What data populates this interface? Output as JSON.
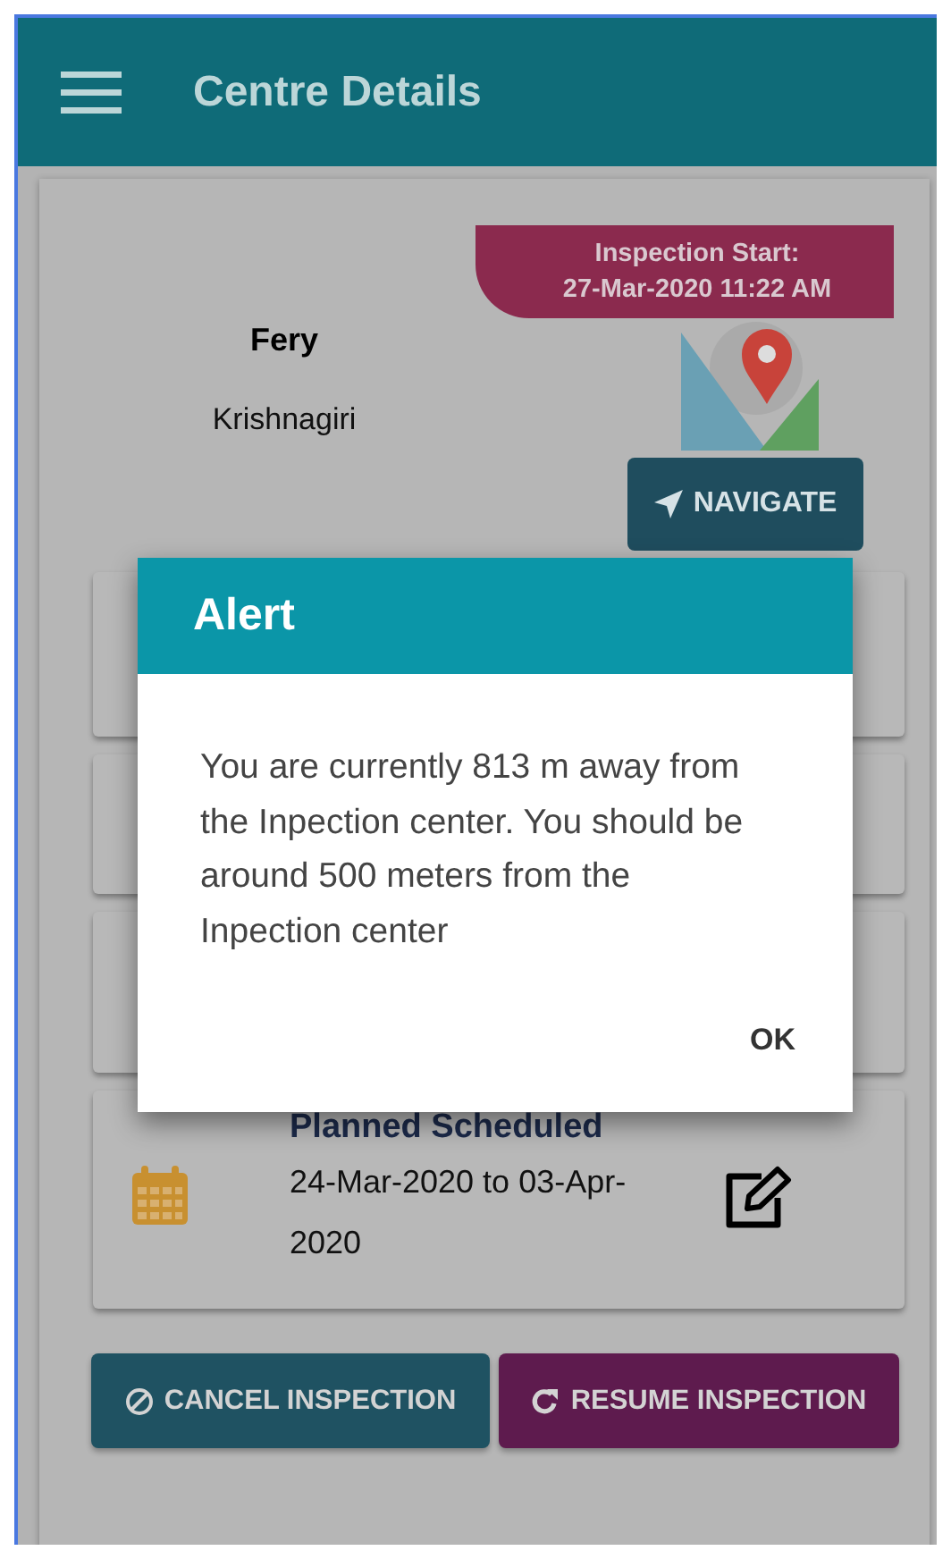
{
  "app_bar": {
    "title": "Centre Details"
  },
  "centre": {
    "name": "Fery",
    "location": "Krishnagiri",
    "inspection_start_label": "Inspection Start:",
    "inspection_start": "27-Mar-2020 11:22 AM",
    "navigate_button": "NAVIGATE"
  },
  "schedule": {
    "title": "Planned Scheduled",
    "dates": "24-Mar-2020 to 03-Apr-2020"
  },
  "actions": [
    {
      "label": "CANCEL INSPECTION",
      "kind": "cancel"
    },
    {
      "label": "RESUME INSPECTION",
      "kind": "resume"
    }
  ],
  "alert": {
    "title": "Alert",
    "message": "You are currently 813 m away from the Inpection center. You should be around 500 meters from the Inpection center",
    "button": "OK"
  }
}
